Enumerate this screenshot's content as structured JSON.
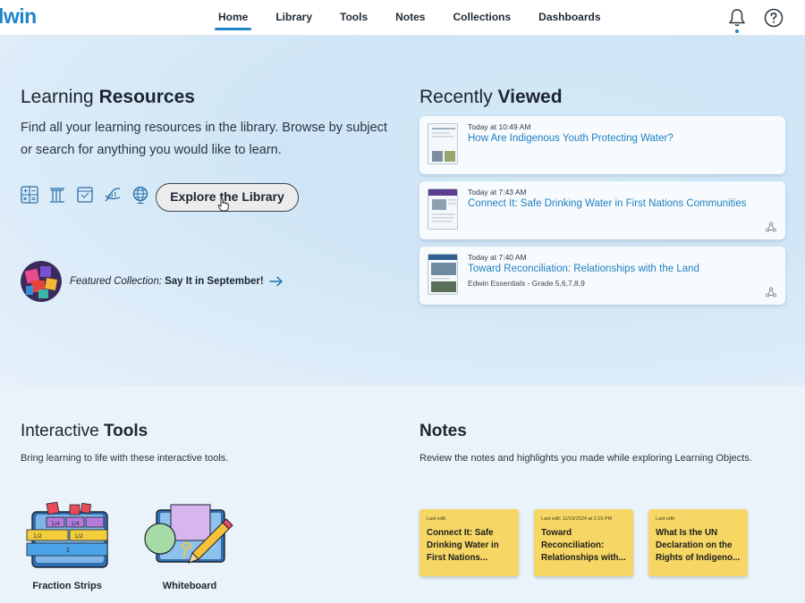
{
  "app": {
    "logo": "lwin"
  },
  "nav": {
    "items": [
      {
        "label": "Home",
        "active": true
      },
      {
        "label": "Library",
        "active": false
      },
      {
        "label": "Tools",
        "active": false
      },
      {
        "label": "Notes",
        "active": false
      },
      {
        "label": "Collections",
        "active": false
      },
      {
        "label": "Dashboards",
        "active": false
      }
    ],
    "icons": [
      "bell-icon",
      "help-icon"
    ]
  },
  "learning": {
    "title_prefix": "Learning ",
    "title_bold": "Resources",
    "description": "Find all your learning resources in the library. Browse by subject or search for anything you would like to learn.",
    "subject_icons": [
      "math-icon",
      "social-studies-icon",
      "ela-icon",
      "science-icon",
      "globe-icon"
    ],
    "explore_label": "Explore the Library",
    "featured_prefix": "Featured Collection:",
    "featured_name": " Say It in September!"
  },
  "recently_viewed": {
    "title_prefix": "Recently ",
    "title_bold": "Viewed",
    "items": [
      {
        "time": "Today at 10:49 AM",
        "title": "How Are Indigenous Youth Protecting Water?",
        "subtitle": ""
      },
      {
        "time": "Today at 7:43 AM",
        "title": "Connect It: Safe Drinking Water in First Nations Communities",
        "subtitle": ""
      },
      {
        "time": "Today at 7:40 AM",
        "title": "Toward Reconciliation: Relationships with the Land",
        "subtitle": "Edwin Essentials - Grade 5,6,7,8,9"
      }
    ]
  },
  "tools": {
    "title_prefix": "Interactive ",
    "title_bold": "Tools",
    "description": "Bring learning to life with these interactive tools.",
    "items": [
      {
        "label": "Fraction Strips",
        "icon": "fraction-strips-icon"
      },
      {
        "label": "Whiteboard",
        "icon": "whiteboard-icon"
      }
    ]
  },
  "notes": {
    "title": "Notes",
    "description": "Review the notes and highlights you made while exploring Learning Objects.",
    "items": [
      {
        "meta": "Last edit:",
        "title": "Connect It: Safe Drinking Water in First Nations..."
      },
      {
        "meta": "Last edit: 11/19/2024 at 2:19 PM",
        "title": "Toward Reconciliation: Relationships with..."
      },
      {
        "meta": "Last edit:",
        "title": "What Is the UN Declaration on the Rights of Indigeno..."
      }
    ]
  },
  "colors": {
    "accent": "#1e86c8",
    "link": "#1f7fbf",
    "note": "#f6d765"
  }
}
